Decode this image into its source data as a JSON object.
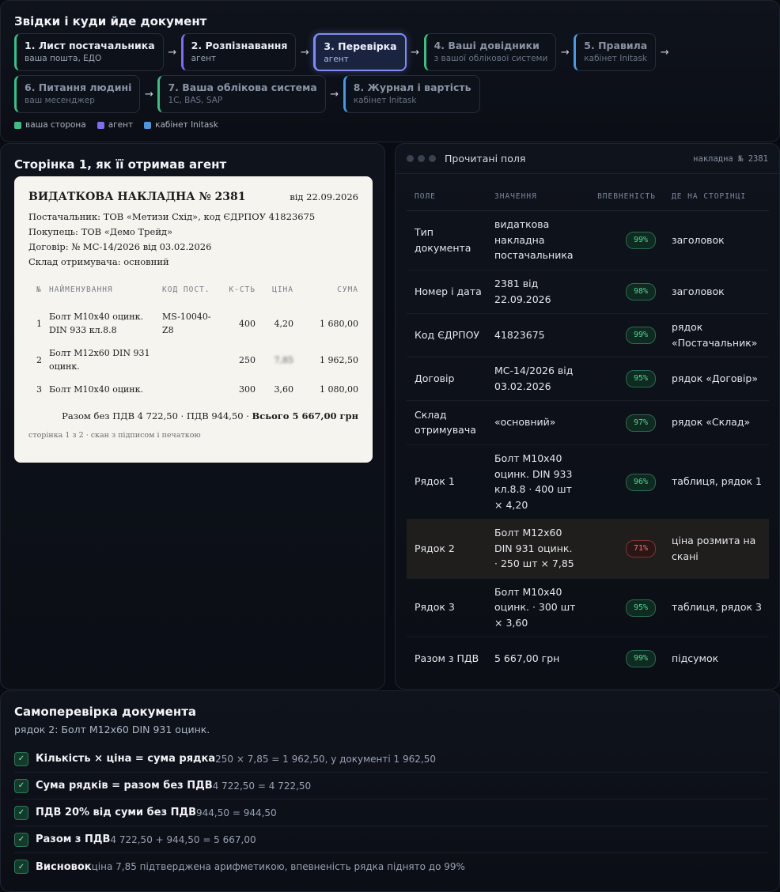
{
  "flow": {
    "title": "Звідки і куди йде документ",
    "steps": [
      {
        "title": "1. Лист постачальника",
        "sub": "ваша пошта, ЕДО"
      },
      {
        "title": "2. Розпізнавання",
        "sub": "агент"
      },
      {
        "title": "3. Перевірка",
        "sub": "агент"
      },
      {
        "title": "4. Ваші довідники",
        "sub": "з вашої облікової системи"
      },
      {
        "title": "5. Правила",
        "sub": "кабінет Initask"
      },
      {
        "title": "6. Питання людині",
        "sub": "ваш месенджер"
      },
      {
        "title": "7. Ваша облікова система",
        "sub": "1С, BAS, SAP"
      },
      {
        "title": "8. Журнал і вартість",
        "sub": "кабінет Initask"
      }
    ],
    "legend": [
      "ваша сторона",
      "агент",
      "кабінет Initask"
    ],
    "colors": {
      "client": "#3fbd82",
      "agent": "#7c6df2",
      "initask": "#4b97e0"
    }
  },
  "document": {
    "title": "Сторінка 1, як її отримав агент",
    "doc_title": "ВИДАТКОВА НАКЛАДНА № 2381",
    "date": "від 22.09.2026",
    "meta": [
      "Постачальник: ТОВ «Метизи Схід», код ЄДРПОУ 41823675",
      "Покупець: ТОВ «Демо Трейд»",
      "Договір: № МС-14/2026 від 03.02.2026",
      "Склад отримувача: основний"
    ],
    "columns": [
      "№",
      "НАЙМЕНУВАННЯ",
      "КОД ПОСТ.",
      "К-СТЬ",
      "ЦІНА",
      "СУМА"
    ],
    "rows": [
      {
        "n": "1",
        "name": "Болт М10х40 оцинк. DIN 933 кл.8.8",
        "code": "MS-10040-Z8",
        "qty": "400",
        "price": "4,20",
        "sum": "1 680,00"
      },
      {
        "n": "2",
        "name": "Болт М12х60 DIN 931 оцинк.",
        "code": "",
        "qty": "250",
        "price": "7,85",
        "sum": "1 962,50"
      },
      {
        "n": "3",
        "name": "Болт М10х40 оцинк.",
        "code": "",
        "qty": "300",
        "price": "3,60",
        "sum": "1 080,00"
      }
    ],
    "summary": "Разом без ПДВ 4 722,50 · ПДВ 944,50 · ",
    "summary_total": "Всього 5 667,00 грн",
    "note": "сторінка 1 з 2 · скан з підписом і печаткою"
  },
  "fields": {
    "window_title": "Прочитані поля",
    "window_ref": "накладна № 2381",
    "columns": [
      "ПОЛЕ",
      "ЗНАЧЕННЯ",
      "ВПЕВНЕНІСТЬ",
      "ДЕ НА СТОРІНЦІ"
    ],
    "rows": [
      {
        "field": "Тип документа",
        "value": "видаткова накладна постачальника",
        "conf": "99%",
        "where": "заголовок"
      },
      {
        "field": "Номер і дата",
        "value": "2381 від 22.09.2026",
        "conf": "98%",
        "where": "заголовок"
      },
      {
        "field": "Код ЄДРПОУ",
        "value": "41823675",
        "conf": "99%",
        "where": "рядок «Постачальник»"
      },
      {
        "field": "Договір",
        "value": "МС-14/2026 від 03.02.2026",
        "conf": "95%",
        "where": "рядок «Договір»"
      },
      {
        "field": "Склад отримувача",
        "value": "«основний»",
        "conf": "97%",
        "where": "рядок «Склад»"
      },
      {
        "field": "Рядок 1",
        "value": "Болт М10х40 оцинк. DIN 933 кл.8.8 · 400 шт × 4,20",
        "conf": "96%",
        "where": "таблиця, рядок 1"
      },
      {
        "field": "Рядок 2",
        "value": "Болт М12х60 DIN 931 оцинк. · 250 шт × 7,85",
        "conf": "71%",
        "where": "ціна розмита на скані"
      },
      {
        "field": "Рядок 3",
        "value": "Болт М10х40 оцинк. · 300 шт × 3,60",
        "conf": "95%",
        "where": "таблиця, рядок 3"
      },
      {
        "field": "Разом з ПДВ",
        "value": "5 667,00 грн",
        "conf": "99%",
        "where": "підсумок"
      }
    ]
  },
  "check": {
    "title": "Самоперевірка документа",
    "subtitle": "рядок 2: Болт М12х60 DIN 931 оцинк.",
    "items": [
      {
        "label": "Кількість × ціна = сума рядка",
        "value": "250 × 7,85 = 1 962,50, у документі 1 962,50"
      },
      {
        "label": "Сума рядків = разом без ПДВ",
        "value": "4 722,50 = 4 722,50"
      },
      {
        "label": "ПДВ 20% від суми без ПДВ",
        "value": "944,50 = 944,50"
      },
      {
        "label": "Разом з ПДВ",
        "value": "4 722,50 + 944,50 = 5 667,00"
      },
      {
        "label": "Висновок",
        "value": "ціна 7,85 підтверджена арифметикою, впевненість рядка піднято до 99%"
      }
    ]
  }
}
